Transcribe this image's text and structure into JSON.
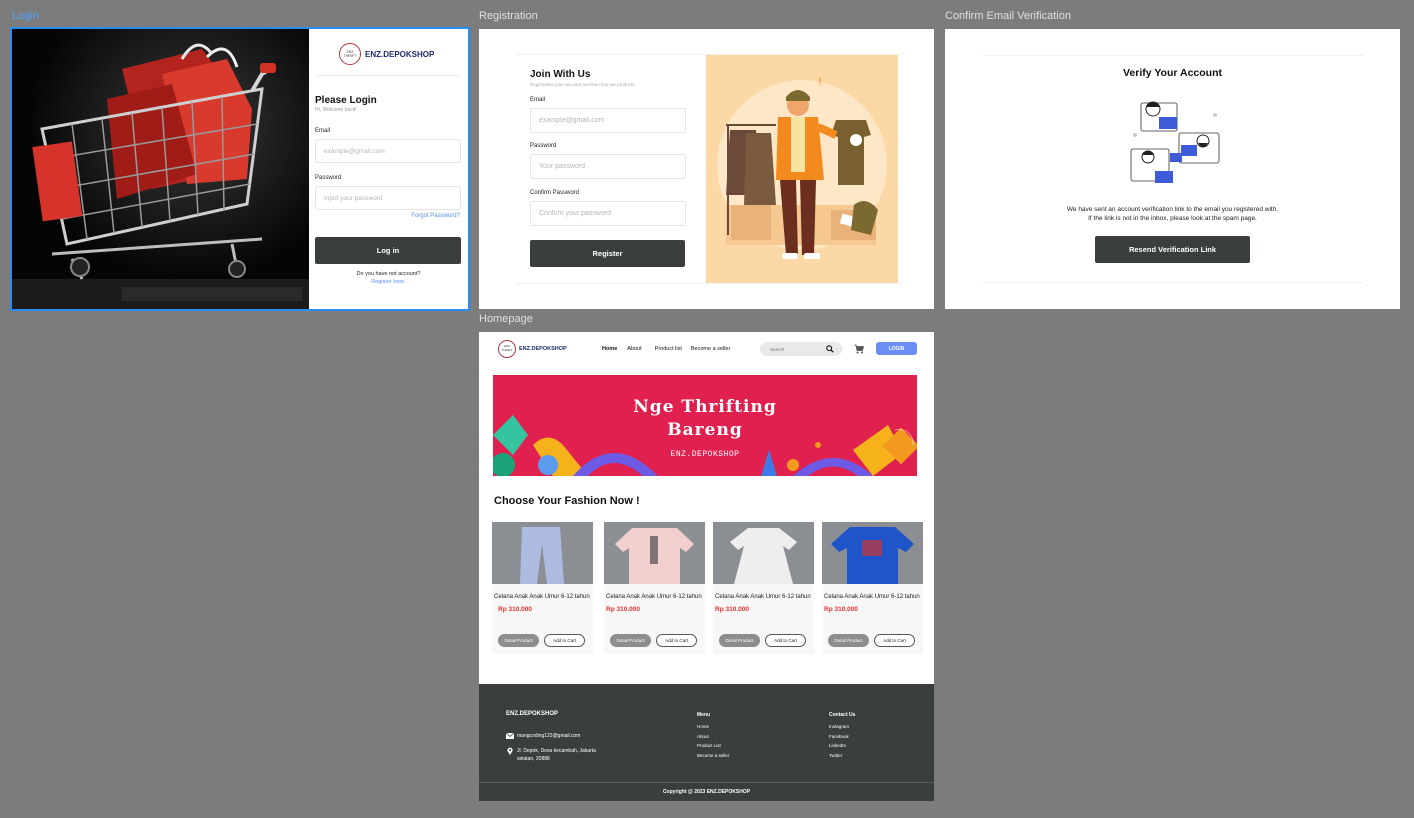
{
  "frames": {
    "login": "Login",
    "registration": "Registration",
    "confirm": "Confirm Email Verification",
    "homepage": "Homepage"
  },
  "brand": {
    "logo_text": "ENZ.DEPOKSHOP",
    "badge_top": "ENZ",
    "badge_bottom": "THRIFT"
  },
  "colors": {
    "dark": "#3b3e3e",
    "accent_blue": "#6b8ef5",
    "banner": "#e0204f",
    "price_red": "#e5322d",
    "link": "#5b8def"
  },
  "login": {
    "title": "Please Login",
    "subtitle": "Hi, Welcome back!",
    "email_label": "Email",
    "email_placeholder": "example@gmail.com",
    "password_label": "Password",
    "password_placeholder": "Input your password",
    "forgot": "Forgot Password?",
    "button": "Log in",
    "no_account": "Do you have not account?",
    "register_link": "Register here."
  },
  "register": {
    "title": "Join With Us",
    "subtitle": "Registration your account and then buy our products.",
    "email_label": "Email",
    "email_placeholder": "example@gmail.com",
    "password_label": "Password",
    "password_placeholder": "Your password",
    "confirm_label": "Confirm Password",
    "confirm_placeholder": "Confirm your password",
    "button": "Register"
  },
  "verify": {
    "title": "Verify Your Account",
    "line1": "We have sent an account verification link to the email  you registered with.",
    "line2": "If the link is not in the inbox, please look at the spam page.",
    "button": "Resend Verification Link"
  },
  "home": {
    "nav": [
      "Home",
      "About",
      "Product list",
      "Become a seller"
    ],
    "search_placeholder": "Search",
    "login_button": "LOGIN",
    "banner_line1": "Nge Thrifting",
    "banner_line2": "Bareng",
    "banner_brand": "ENZ.DEPOKSHOP",
    "section_title": "Choose Your Fashion Now !",
    "products": [
      {
        "name": "Celana Anak Anak Umur 6-12 tahun",
        "price": "Rp 310.000",
        "detail": "Detail Product",
        "cart": "Add to Cart"
      },
      {
        "name": "Celana Anak Anak Umur 6-12 tahun",
        "price": "Rp 310.000",
        "detail": "Detail Product",
        "cart": "Add to Cart"
      },
      {
        "name": "Celana Anak Anak Umur 6-12 tahun",
        "price": "Rp 310.000",
        "detail": "Detail Product",
        "cart": "Add to Cart"
      },
      {
        "name": "Celana Anak Anak Umur 6-12 tahun",
        "price": "Rp 310.000",
        "detail": "Detail Product",
        "cart": "Add to Cart"
      }
    ],
    "footer": {
      "brand": "ENZ.DEPOKSHOP",
      "email": "mangcoding123@gmail.com",
      "address_line1": "Jl. Depok, Desa kecambah, Jakarta",
      "address_line2": "selatan, 20888",
      "menu_title": "Menu",
      "menu": [
        "Home",
        "About",
        "Product List",
        "Become a seller"
      ],
      "contact_title": "Contact Us",
      "contact": [
        "Instagram",
        "Facebook",
        "LinkedIn",
        "Twitter"
      ],
      "copyright": "Copyright @ 2023 ENZ.DEPOKSHOP"
    }
  }
}
